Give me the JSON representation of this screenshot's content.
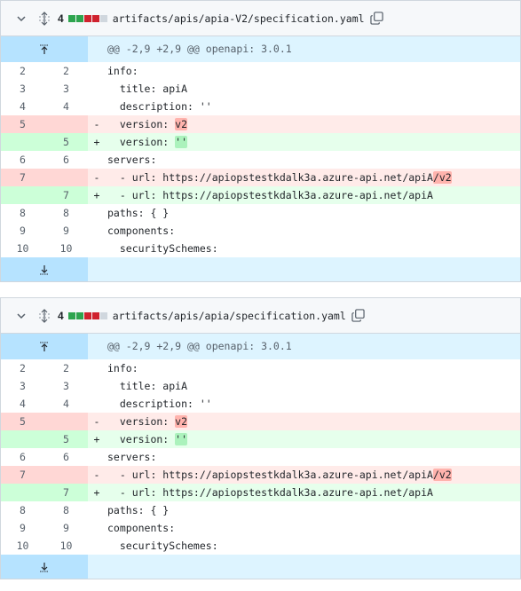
{
  "colors": {
    "add": "#2da44e",
    "del": "#cf222e",
    "neutral": "#d0d7de"
  },
  "files": [
    {
      "changes": "4",
      "stat": [
        "add",
        "add",
        "del",
        "del",
        "neutral"
      ],
      "path": "artifacts/apis/apia-V2/specification.yaml",
      "hunk": "@@ -2,9 +2,9 @@ openapi: 3.0.1",
      "lines": [
        {
          "t": "ctx",
          "o": "2",
          "n": "2",
          "s": "",
          "pre": "info:",
          "hl": "",
          "post": ""
        },
        {
          "t": "ctx",
          "o": "3",
          "n": "3",
          "s": "",
          "pre": "  title: apiA",
          "hl": "",
          "post": ""
        },
        {
          "t": "ctx",
          "o": "4",
          "n": "4",
          "s": "",
          "pre": "  description: ''",
          "hl": "",
          "post": ""
        },
        {
          "t": "del",
          "o": "5",
          "n": "",
          "s": "-",
          "pre": "  version: ",
          "hl": "v2",
          "post": ""
        },
        {
          "t": "add",
          "o": "",
          "n": "5",
          "s": "+",
          "pre": "  version: ",
          "hl": "''",
          "post": ""
        },
        {
          "t": "ctx",
          "o": "6",
          "n": "6",
          "s": "",
          "pre": "servers:",
          "hl": "",
          "post": ""
        },
        {
          "t": "del",
          "o": "7",
          "n": "",
          "s": "-",
          "pre": "  - url: https://apiopstestkdalk3a.azure-api.net/apiA",
          "hl": "/v2",
          "post": ""
        },
        {
          "t": "add",
          "o": "",
          "n": "7",
          "s": "+",
          "pre": "  - url: https://apiopstestkdalk3a.azure-api.net/apiA",
          "hl": "",
          "post": ""
        },
        {
          "t": "ctx",
          "o": "8",
          "n": "8",
          "s": "",
          "pre": "paths: { }",
          "hl": "",
          "post": ""
        },
        {
          "t": "ctx",
          "o": "9",
          "n": "9",
          "s": "",
          "pre": "components:",
          "hl": "",
          "post": ""
        },
        {
          "t": "ctx",
          "o": "10",
          "n": "10",
          "s": "",
          "pre": "  securitySchemes:",
          "hl": "",
          "post": ""
        }
      ]
    },
    {
      "changes": "4",
      "stat": [
        "add",
        "add",
        "del",
        "del",
        "neutral"
      ],
      "path": "artifacts/apis/apia/specification.yaml",
      "hunk": "@@ -2,9 +2,9 @@ openapi: 3.0.1",
      "lines": [
        {
          "t": "ctx",
          "o": "2",
          "n": "2",
          "s": "",
          "pre": "info:",
          "hl": "",
          "post": ""
        },
        {
          "t": "ctx",
          "o": "3",
          "n": "3",
          "s": "",
          "pre": "  title: apiA",
          "hl": "",
          "post": ""
        },
        {
          "t": "ctx",
          "o": "4",
          "n": "4",
          "s": "",
          "pre": "  description: ''",
          "hl": "",
          "post": ""
        },
        {
          "t": "del",
          "o": "5",
          "n": "",
          "s": "-",
          "pre": "  version: ",
          "hl": "v2",
          "post": ""
        },
        {
          "t": "add",
          "o": "",
          "n": "5",
          "s": "+",
          "pre": "  version: ",
          "hl": "''",
          "post": ""
        },
        {
          "t": "ctx",
          "o": "6",
          "n": "6",
          "s": "",
          "pre": "servers:",
          "hl": "",
          "post": ""
        },
        {
          "t": "del",
          "o": "7",
          "n": "",
          "s": "-",
          "pre": "  - url: https://apiopstestkdalk3a.azure-api.net/apiA",
          "hl": "/v2",
          "post": ""
        },
        {
          "t": "add",
          "o": "",
          "n": "7",
          "s": "+",
          "pre": "  - url: https://apiopstestkdalk3a.azure-api.net/apiA",
          "hl": "",
          "post": ""
        },
        {
          "t": "ctx",
          "o": "8",
          "n": "8",
          "s": "",
          "pre": "paths: { }",
          "hl": "",
          "post": ""
        },
        {
          "t": "ctx",
          "o": "9",
          "n": "9",
          "s": "",
          "pre": "components:",
          "hl": "",
          "post": ""
        },
        {
          "t": "ctx",
          "o": "10",
          "n": "10",
          "s": "",
          "pre": "  securitySchemes:",
          "hl": "",
          "post": ""
        }
      ]
    }
  ]
}
